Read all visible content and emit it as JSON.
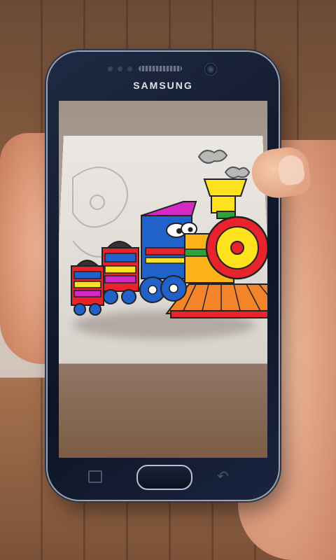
{
  "phone": {
    "brand": "SAMSUNG"
  },
  "icons": {
    "home": "home-button",
    "recent": "recent-apps-icon",
    "back": "back-icon"
  },
  "colors": {
    "phone_body": "#0d1424",
    "train_red": "#e8232b",
    "train_yellow": "#ffe21e",
    "train_blue": "#2062c9",
    "train_magenta": "#d429c6"
  }
}
